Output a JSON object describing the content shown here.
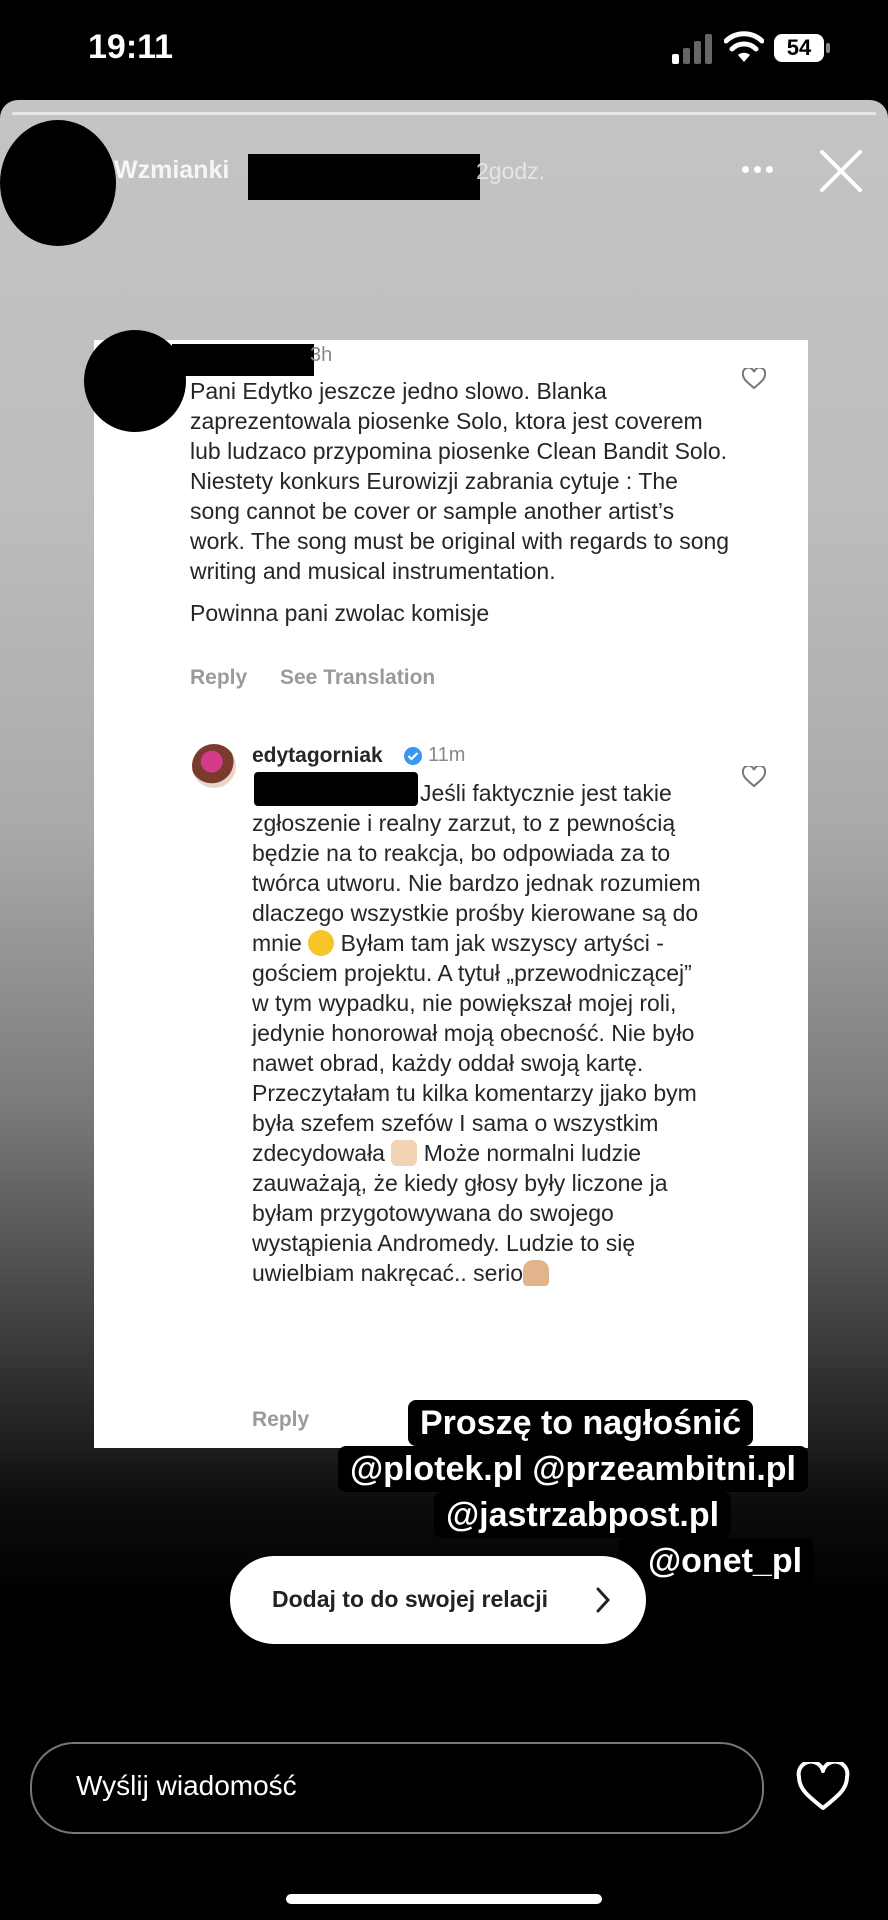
{
  "status_bar": {
    "time": "19:11",
    "battery": "54"
  },
  "story": {
    "username": "Wzmianki",
    "time_ago": "2godz."
  },
  "comment1": {
    "time": "3h",
    "paragraphs": [
      "Pani Edytko jeszcze jedno slowo. Blanka zaprezentowala piosenke Solo, ktora jest coverem lub ludzaco przypomina piosenke Clean Bandit Solo. Niestety konkurs Eurowizji zabrania cytuje : The song cannot be cover or sample another artist’s work. The song must be original with regards to song writing and musical instrumentation.",
      "Powinna pani zwolac komisje"
    ],
    "reply_label": "Reply",
    "translate_label": "See Translation"
  },
  "comment2": {
    "username": "edytagorniak",
    "time": "11m",
    "text_a": "Jeśli faktycznie jest takie zgłoszenie i realny zarzut, to z pewnością będzie na to reakcja, bo odpowiada za to twórca utworu. Nie bardzo jednak rozumiem dlaczego wszystkie prośby kierowane są do mnie",
    "text_b": "Byłam tam jak wszyscy artyści - gościem projektu. A tytuł „przewodniczącej” w tym wypadku, nie powiększał mojej roli, jedynie honorował moją obecność. Nie było nawet obrad, każdy oddał swoją kartę. Przeczytałam tu kilka komentarzy jjako bym była szefem szefów I sama o wszystkim zdecydowała",
    "text_c": "Może normalni ludzie zauważają, że kiedy głosy były liczone ja byłam przygotowywana do swojego wystąpienia Andromedy. Ludzie to się uwielbiam nakręcać.. serio",
    "reply_label": "Reply"
  },
  "captions": {
    "line1": "Proszę to nagłośnić",
    "line2": "@plotek.pl @przeambitni.pl",
    "line3": "@jastrzabpost.pl",
    "line4": "@onet_pl"
  },
  "add_to_story": "Dodaj to do swojej relacji",
  "message_placeholder": "Wyślij wiadomość"
}
